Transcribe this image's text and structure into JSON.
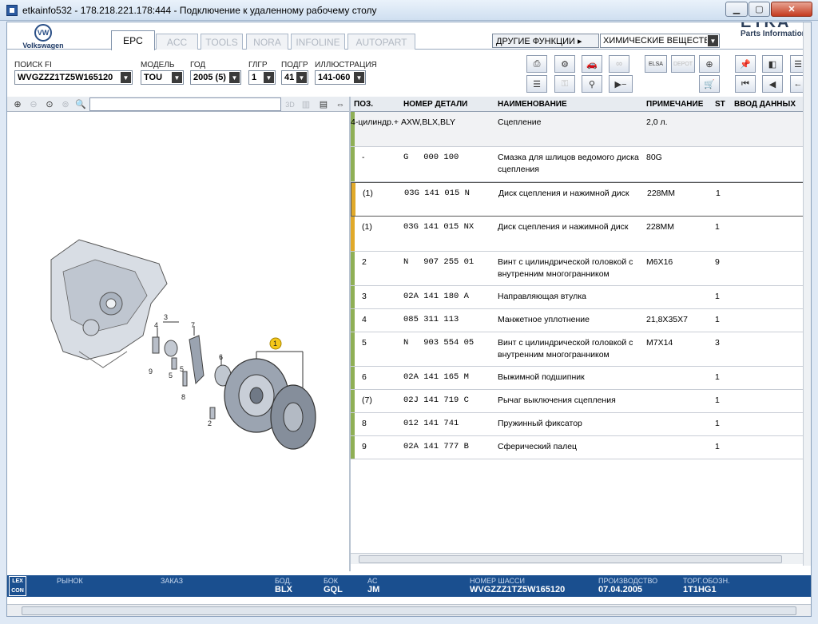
{
  "window": {
    "title": "etkainfo532 - 178.218.221.178:444 - Подключение к удаленному рабочему столу"
  },
  "brand": {
    "maker": "Volkswagen",
    "vw_logo_text": "VW",
    "etka_title": "ETKA",
    "etka_sub": "Parts Information"
  },
  "tabs": [
    {
      "label": "EPC",
      "active": true
    },
    {
      "label": "ACC",
      "active": false
    },
    {
      "label": "TOOLS",
      "active": false
    },
    {
      "label": "NORA",
      "active": false
    },
    {
      "label": "INFOLINE",
      "active": false
    },
    {
      "label": "AUTOPART",
      "active": false
    }
  ],
  "functions": {
    "button": "ДРУГИЕ ФУНКЦИИ ▸",
    "selected": "ХИМИЧЕСКИЕ ВЕЩЕСТВА"
  },
  "filters": {
    "search": {
      "label": "ПОИСК FI",
      "value": "WVGZZZ1TZ5W165120"
    },
    "model": {
      "label": "МОДЕЛЬ",
      "value": "TOU"
    },
    "year": {
      "label": "ГОД",
      "value": "2005 (5)"
    },
    "glgr": {
      "label": "ГЛГР",
      "value": "1"
    },
    "podgr": {
      "label": "ПОДГР",
      "value": "41"
    },
    "illustration": {
      "label": "ИЛЛЮСТРАЦИЯ",
      "value": "141-060"
    }
  },
  "toolbar_icons": [
    "print-icon",
    "parts-icon",
    "car-icon",
    "chain-icon",
    "elsa-icon",
    "depot-icon",
    "cart-add-icon",
    "pin-icon",
    "page-icon",
    "list-icon",
    "key-icon",
    "bike-icon",
    "play-minus-icon",
    "cart-icon",
    "first-icon",
    "prev-icon"
  ],
  "toolbar_texts": {
    "elsa": "ELSA",
    "depot": "DEPOT"
  },
  "illus_toolbar": {
    "three_d": "3D"
  },
  "table": {
    "columns": {
      "pos": "ПОЗ.",
      "number": "НОМЕР ДЕТАЛИ",
      "name": "НАИМЕНОВАНИЕ",
      "note": "ПРИМЕЧАНИЕ",
      "st": "ST",
      "input": "ВВОД ДАННЫХ"
    },
    "rows": [
      {
        "pos": "",
        "number": "",
        "name": "Сцепление",
        "note": "2,0 л.",
        "st": "",
        "input": "4-цилиндр.+ AXW,BLX,BLY",
        "marker": "#8faf55",
        "height": 44,
        "header": true
      },
      {
        "pos": "-",
        "number": "G   000 100",
        "name": "Смазка для шлицов ведомого диска сцепления",
        "note": "80G",
        "st": "",
        "input": "",
        "marker": "#8faf55",
        "height": 44
      },
      {
        "pos": "(1)",
        "number": "03G 141 015 N",
        "name": "Диск сцепления и нажимной диск",
        "note": "228MM",
        "st": "1",
        "input": "",
        "marker": "#e0a92a",
        "height": 43,
        "selected": true
      },
      {
        "pos": "(1)",
        "number": "03G 141 015 NX",
        "name": "Диск сцепления и нажимной диск",
        "note": "228MM",
        "st": "1",
        "input": "",
        "marker": "#e0a92a",
        "height": 44
      },
      {
        "pos": "2",
        "number": "N   907 255 01",
        "name": "Винт с цилиндрической головкой с внутренним многогранником",
        "note": "M6X16",
        "st": "9",
        "input": "",
        "marker": "#8faf55",
        "height": 43
      },
      {
        "pos": "3",
        "number": "02A 141 180 A",
        "name": "Направляющая втулка",
        "note": "",
        "st": "1",
        "input": "",
        "marker": "#8faf55",
        "height": 29
      },
      {
        "pos": "4",
        "number": "085 311 113",
        "name": "Манжетное уплотнение",
        "note": "21,8X35X7",
        "st": "1",
        "input": "",
        "marker": "#8faf55",
        "height": 29
      },
      {
        "pos": "5",
        "number": "N   903 554 05",
        "name": "Винт с цилиндрической головкой с внутренним многогранником",
        "note": "M7X14",
        "st": "3",
        "input": "",
        "marker": "#8faf55",
        "height": 43
      },
      {
        "pos": "6",
        "number": "02A 141 165 M",
        "name": "Выжимной подшипник",
        "note": "",
        "st": "1",
        "input": "",
        "marker": "#8faf55",
        "height": 29
      },
      {
        "pos": "(7)",
        "number": "02J 141 719 C",
        "name": "Рычаг выключения сцепления",
        "note": "",
        "st": "1",
        "input": "",
        "marker": "#8faf55",
        "height": 29
      },
      {
        "pos": "8",
        "number": "012 141 741",
        "name": "Пружинный фиксатор",
        "note": "",
        "st": "1",
        "input": "",
        "marker": "#8faf55",
        "height": 29
      },
      {
        "pos": "9",
        "number": "02A 141 777 B",
        "name": "Сферический палец",
        "note": "",
        "st": "1",
        "input": "",
        "marker": "#8faf55",
        "height": 29
      }
    ]
  },
  "callouts": [
    "1",
    "2",
    "3",
    "4",
    "5",
    "5",
    "6",
    "7",
    "8",
    "9"
  ],
  "status": {
    "lex": "LEX CON",
    "market": {
      "label": "РЫНОК",
      "value": ""
    },
    "order": {
      "label": "ЗАКАЗ",
      "value": ""
    },
    "bod": {
      "label": "БОД.",
      "value": "BLX"
    },
    "bok": {
      "label": "БОК",
      "value": "GQL"
    },
    "ac": {
      "label": "AC",
      "value": "JM"
    },
    "chassis": {
      "label": "НОМЕР ШАССИ",
      "value": "WVGZZZ1TZ5W165120"
    },
    "production": {
      "label": "ПРОИЗВОДСТВО",
      "value": "07.04.2005"
    },
    "trade": {
      "label": "ТОРГ.ОБОЗН.",
      "value": "1T1HG1"
    }
  }
}
